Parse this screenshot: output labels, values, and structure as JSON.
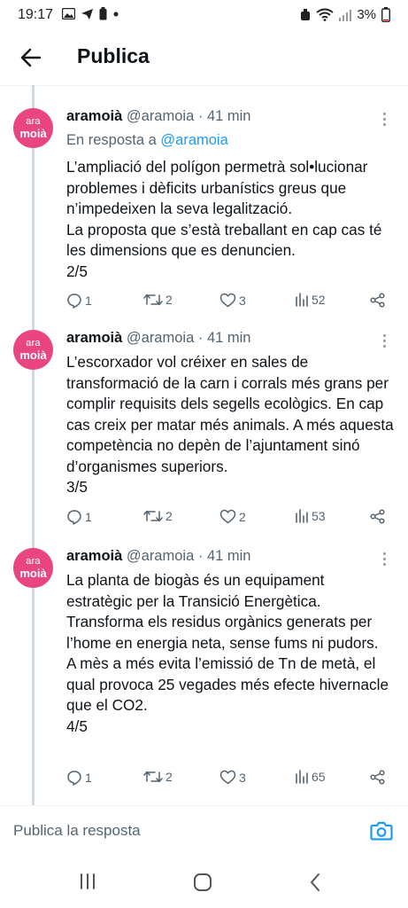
{
  "status_bar": {
    "time": "19:17",
    "battery": "3%"
  },
  "header": {
    "title": "Publica"
  },
  "tweets": [
    {
      "name": "aramoià",
      "handle": "@aramoia",
      "time": "· 41 min",
      "reply_prefix": "En resposta a ",
      "reply_mention": "@aramoia",
      "text": "L’ampliació del polígon permetrà sol•lucionar problemes i dèficits urbanístics greus que n’impedeixen la seva legalització.\nLa proposta que s’està treballant en cap cas té les dimensions que es denuncien.\n2/5",
      "replies": "1",
      "retweets": "2",
      "likes": "3",
      "views": "52"
    },
    {
      "name": "aramoià",
      "handle": "@aramoia",
      "time": "· 41 min",
      "text": "L’escorxador vol créixer en sales de transformació de la carn i corrals més grans per complir requisits dels segells ecològics. En cap cas creix per matar més animals. A més aquesta competència no depèn de l’ajuntament sinó d’organismes superiors.\n3/5",
      "replies": "1",
      "retweets": "2",
      "likes": "2",
      "views": "53"
    },
    {
      "name": "aramoià",
      "handle": "@aramoia",
      "time": "· 41 min",
      "text": "La planta de biogàs és un equipament estratègic per la Transició Energètica.\nTransforma els residus orgànics generats per l’home en energia neta, sense fums ni pudors.\nA mès a més evita l’emissió de Tn de metà, el qual provoca 25 vegades més efecte hivernacle que el CO2.\n4/5",
      "replies": "1",
      "retweets": "2",
      "likes": "3",
      "views": "65"
    }
  ],
  "avatar": {
    "line1": "ara",
    "line2": "moià",
    "color": "#e94580"
  },
  "reply_bar": {
    "placeholder": "Publica la resposta"
  },
  "colors": {
    "accent": "#1d9bf0",
    "secondary_text": "#536471"
  }
}
